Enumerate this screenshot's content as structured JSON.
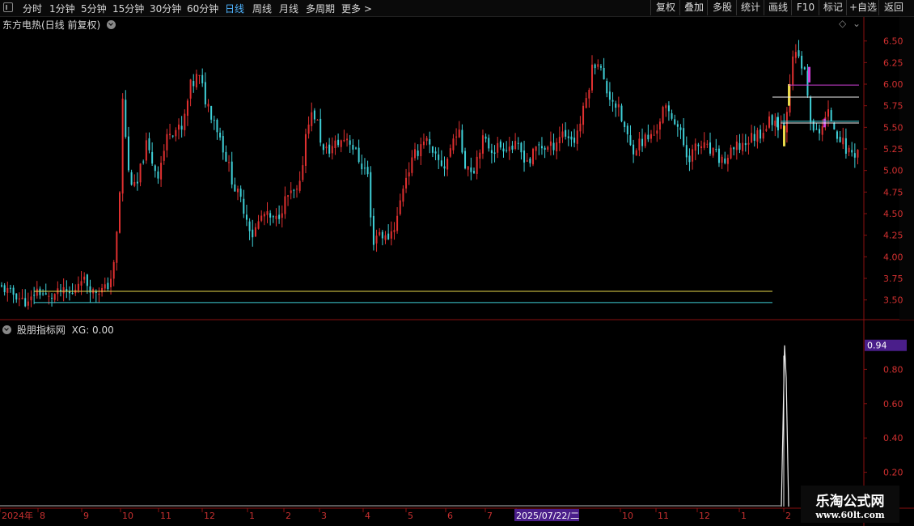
{
  "toolbar": {
    "periods": [
      "分时",
      "1分钟",
      "5分钟",
      "15分钟",
      "30分钟",
      "60分钟",
      "日线",
      "周线",
      "月线",
      "多周期",
      "更多 >"
    ],
    "active_period": "日线",
    "right_buttons": [
      "复权",
      "叠加",
      "多股",
      "统计",
      "画线",
      "F10",
      "标记",
      "+自选",
      "返回"
    ]
  },
  "main_title": "东方电热(日线 前复权)",
  "indicator_title": "股朋指标网",
  "indicator_value": "XG: 0.00",
  "indicator_current": "0.94",
  "watermark": {
    "title": "乐淘公式网",
    "url": "www.60lt.com"
  },
  "colors": {
    "up": "#e03030",
    "down": "#3fd0d8",
    "yellow": "#e8d84a",
    "magenta": "#d040d8",
    "white": "#f0f0f0",
    "axis": "#8a1010",
    "highlight": "#4a1e8a"
  },
  "chart_data": [
    {
      "type": "candlestick",
      "ylim": [
        3.3,
        6.6
      ],
      "y_ticks": [
        "6.50",
        "6.25",
        "6.00",
        "5.75",
        "5.50",
        "5.25",
        "5.00",
        "4.75",
        "4.50",
        "4.25",
        "4.00",
        "3.75",
        "3.50"
      ],
      "close_path": [
        [
          0,
          3.65
        ],
        [
          20,
          3.55
        ],
        [
          35,
          3.45
        ],
        [
          45,
          3.62
        ],
        [
          60,
          3.52
        ],
        [
          75,
          3.6
        ],
        [
          90,
          3.56
        ],
        [
          100,
          3.78
        ],
        [
          115,
          3.6
        ],
        [
          128,
          3.62
        ],
        [
          135,
          3.68
        ],
        [
          142,
          3.95
        ],
        [
          148,
          4.75
        ],
        [
          152,
          5.9
        ],
        [
          158,
          5.0
        ],
        [
          168,
          4.75
        ],
        [
          180,
          5.3
        ],
        [
          195,
          4.95
        ],
        [
          210,
          5.5
        ],
        [
          225,
          5.45
        ],
        [
          235,
          5.95
        ],
        [
          245,
          6.1
        ],
        [
          255,
          5.8
        ],
        [
          265,
          5.6
        ],
        [
          275,
          5.3
        ],
        [
          290,
          4.8
        ],
        [
          300,
          4.6
        ],
        [
          312,
          4.25
        ],
        [
          325,
          4.5
        ],
        [
          340,
          4.4
        ],
        [
          355,
          4.7
        ],
        [
          370,
          4.75
        ],
        [
          380,
          5.6
        ],
        [
          390,
          5.65
        ],
        [
          400,
          5.2
        ],
        [
          415,
          5.3
        ],
        [
          430,
          5.4
        ],
        [
          445,
          5.1
        ],
        [
          455,
          4.95
        ],
        [
          460,
          4.15
        ],
        [
          468,
          4.3
        ],
        [
          478,
          4.2
        ],
        [
          490,
          4.4
        ],
        [
          500,
          4.9
        ],
        [
          512,
          5.15
        ],
        [
          525,
          5.4
        ],
        [
          535,
          5.15
        ],
        [
          550,
          5.05
        ],
        [
          565,
          5.5
        ],
        [
          575,
          5.1
        ],
        [
          585,
          5.0
        ],
        [
          595,
          5.35
        ],
        [
          610,
          5.25
        ],
        [
          625,
          5.3
        ],
        [
          640,
          5.25
        ],
        [
          655,
          5.1
        ],
        [
          665,
          5.3
        ],
        [
          680,
          5.25
        ],
        [
          695,
          5.45
        ],
        [
          710,
          5.35
        ],
        [
          722,
          5.7
        ],
        [
          730,
          6.1
        ],
        [
          738,
          6.35
        ],
        [
          748,
          5.95
        ],
        [
          760,
          5.8
        ],
        [
          770,
          5.55
        ],
        [
          780,
          5.25
        ],
        [
          795,
          5.35
        ],
        [
          808,
          5.4
        ],
        [
          820,
          5.7
        ],
        [
          835,
          5.6
        ],
        [
          850,
          5.15
        ],
        [
          865,
          5.3
        ],
        [
          880,
          5.2
        ],
        [
          895,
          5.1
        ],
        [
          910,
          5.25
        ],
        [
          925,
          5.35
        ],
        [
          940,
          5.45
        ],
        [
          955,
          5.6
        ],
        [
          970,
          5.5
        ],
        [
          978,
          6.2
        ],
        [
          986,
          6.35
        ],
        [
          995,
          6.1
        ],
        [
          1005,
          5.4
        ],
        [
          1015,
          5.5
        ],
        [
          1025,
          5.65
        ],
        [
          1035,
          5.45
        ],
        [
          1045,
          5.25
        ],
        [
          1055,
          5.2
        ],
        [
          1062,
          5.25
        ]
      ],
      "horizontal_lines": [
        {
          "y": 3.6,
          "x_from": 42,
          "x_to": 955,
          "color": "yellow"
        },
        {
          "y": 3.47,
          "x_from": 42,
          "x_to": 955,
          "color": "down"
        },
        {
          "y": 5.99,
          "x_from": 975,
          "x_to": 1062,
          "color": "magenta"
        },
        {
          "y": 5.85,
          "x_from": 955,
          "x_to": 1062,
          "color": "white"
        },
        {
          "y": 5.57,
          "x_from": 965,
          "x_to": 1062,
          "color": "down"
        },
        {
          "y": 5.55,
          "x_from": 965,
          "x_to": 1062,
          "color": "white"
        }
      ]
    },
    {
      "type": "spike",
      "series": [
        {
          "values": [
            0,
            0.94,
            0.75,
            0
          ]
        }
      ],
      "y_ticks": [
        "0.80",
        "0.60",
        "0.40",
        "0.20"
      ],
      "ylim": [
        0,
        1.0
      ],
      "current": 0.94
    }
  ],
  "x_axis": {
    "labels": [
      "2024年",
      "8",
      "9",
      "10",
      "11",
      "12",
      "1",
      "2",
      "3",
      "4",
      "5",
      "6",
      "7",
      "2025/07/22/二",
      "10",
      "11",
      "12",
      "1",
      "2"
    ],
    "positions": [
      0,
      47,
      101,
      149,
      196,
      250,
      306,
      351,
      395,
      449,
      502,
      551,
      600,
      638,
      767,
      811,
      862,
      914,
      969
    ]
  }
}
